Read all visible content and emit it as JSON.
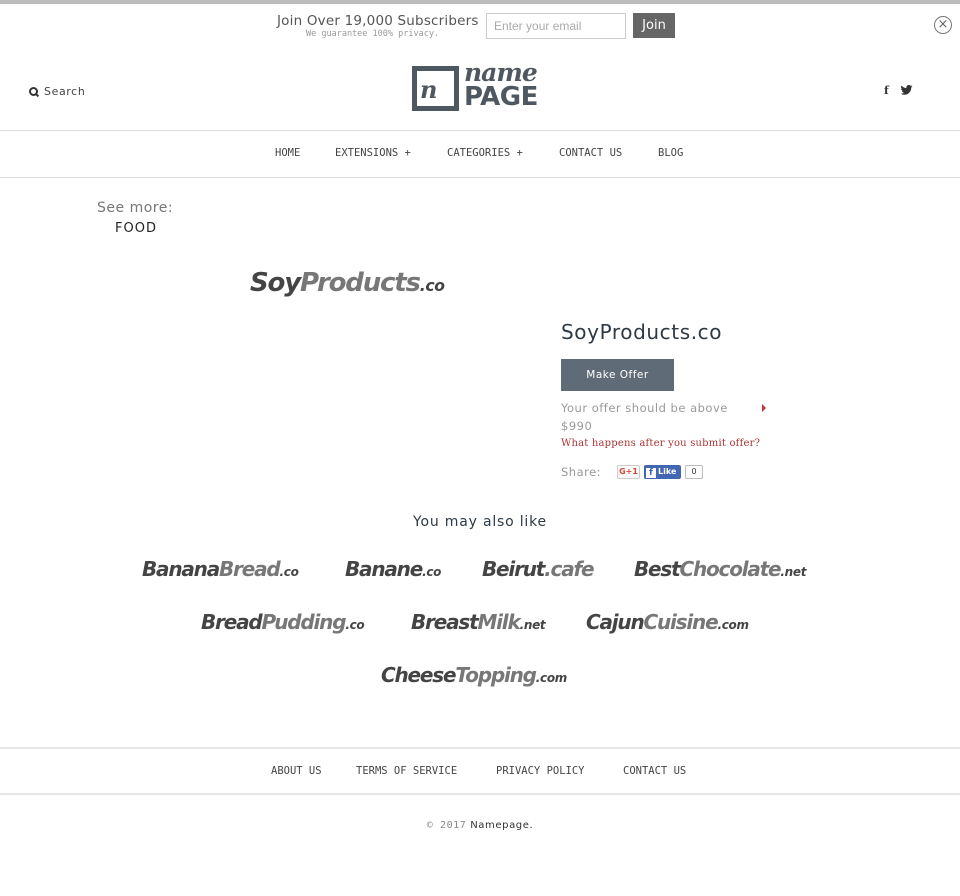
{
  "subscribe": {
    "title": "Join Over 19,000 Subscribers",
    "note": "We guarantee 100% privacy.",
    "email_placeholder": "Enter your email",
    "email_value": "",
    "join_label": "Join",
    "close_icon": "close-circle-icon"
  },
  "header": {
    "search_label": "Search",
    "search_icon": "search-icon",
    "logo": {
      "mark": "n",
      "line1": "name",
      "line2": "PAGE"
    },
    "social": [
      {
        "name": "facebook-icon",
        "glyph": "f"
      },
      {
        "name": "twitter-icon",
        "glyph": "🐦"
      }
    ]
  },
  "nav": {
    "items": [
      {
        "label": "HOME"
      },
      {
        "label": "EXTENSIONS +"
      },
      {
        "label": "CATEGORIES +"
      },
      {
        "label": "CONTACT US"
      },
      {
        "label": "BLOG"
      }
    ]
  },
  "see_more": {
    "label": "See more:",
    "category": "FOOD"
  },
  "product": {
    "logo": {
      "part_a": "Soy",
      "part_b": "Products",
      "tld": ".co"
    },
    "title": "SoyProducts.co",
    "make_offer_label": "Make Offer",
    "offer_note": "Your offer should be above",
    "offer_price": "$990",
    "what_happens_link": "What happens after you submit offer?",
    "share_label": "Share:",
    "gplus_label": "G+1",
    "fb_like_label": "Like",
    "fb_like_count": "0"
  },
  "also_like": {
    "heading": "You may also like",
    "domains": [
      {
        "a": "Banana",
        "b": "Bread",
        "tld": ".co"
      },
      {
        "a": "Banane",
        "b": "",
        "tld": ".co"
      },
      {
        "a": "Beirut",
        "b": "",
        "tld": ".cafe"
      },
      {
        "a": "Best",
        "b": "Chocolate",
        "tld": ".net"
      },
      {
        "a": "Bread",
        "b": "Pudding",
        "tld": ".co"
      },
      {
        "a": "Breast",
        "b": "Milk",
        "tld": ".net"
      },
      {
        "a": "Cajun",
        "b": "Cuisine",
        "tld": ".com"
      },
      {
        "a": "Cheese",
        "b": "Topping",
        "tld": ".com"
      }
    ]
  },
  "footer": {
    "items": [
      {
        "label": "ABOUT US"
      },
      {
        "label": "TERMS OF SERVICE"
      },
      {
        "label": "PRIVACY POLICY"
      },
      {
        "label": "CONTACT US"
      }
    ],
    "copyright": "© 2017",
    "brand": "Namepage."
  }
}
